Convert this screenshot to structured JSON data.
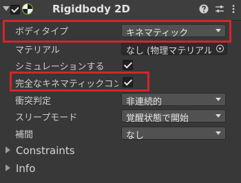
{
  "component": {
    "title": "Rigidbody 2D",
    "enabled": true
  },
  "properties": {
    "body_type": {
      "label": "ボディタイプ",
      "value": "キネマティック"
    },
    "material": {
      "label": "マテリアル",
      "value": "なし (物理マテリアル"
    },
    "simulated": {
      "label": "シミュレーションする",
      "checked": true
    },
    "full_kinematic": {
      "label": "完全なキネマティックコンタ",
      "checked": true
    },
    "collision_detection": {
      "label": "衝突判定",
      "value": "非連続的"
    },
    "sleep_mode": {
      "label": "スリープモード",
      "value": "覚醒状態で開始"
    },
    "interpolate": {
      "label": "補間",
      "value": "なし"
    }
  },
  "sections": [
    {
      "label": "Constraints"
    },
    {
      "label": "Info"
    }
  ],
  "colors": {
    "highlight": "#d9232a",
    "background": "#383838"
  }
}
